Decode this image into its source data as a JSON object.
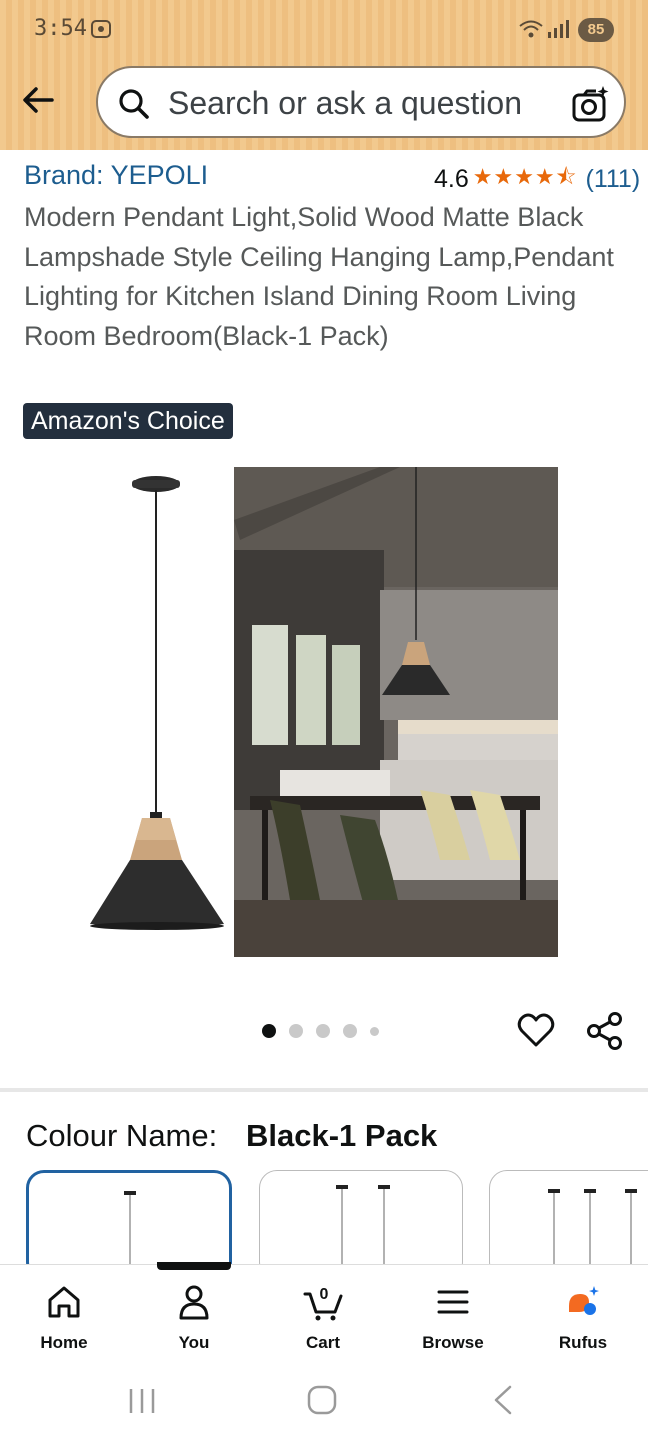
{
  "status_bar": {
    "time": "3:54",
    "battery": "85"
  },
  "search": {
    "placeholder": "Search or ask a question"
  },
  "product": {
    "brand": "Brand: YEPOLI",
    "rating": "4.6",
    "rating_stars": 4.5,
    "stars_glyphs": "★★★★⯪",
    "review_count": "(111)",
    "title": "Modern Pendant Light,Solid Wood Matte Black Lampshade Style Ceiling Hanging Lamp,Pendant Lighting for Kitchen Island Dining Room Living Room Bedroom(Black-1 Pack)",
    "badge": "Amazon's Choice"
  },
  "gallery": {
    "image_count": 5,
    "active_index": 0
  },
  "variant": {
    "label": "Colour Name:",
    "value": "Black-1 Pack"
  },
  "bottom_nav": {
    "items": [
      {
        "label": "Home",
        "icon": "home-icon"
      },
      {
        "label": "You",
        "icon": "person-icon"
      },
      {
        "label": "Cart",
        "icon": "cart-icon",
        "count": "0"
      },
      {
        "label": "Browse",
        "icon": "menu-icon"
      },
      {
        "label": "Rufus",
        "icon": "rufus-icon"
      }
    ]
  },
  "colors": {
    "link": "#1d5d8f",
    "star": "#e8690b",
    "badge_bg": "#232f3e",
    "selected_border": "#2162a1",
    "header_bg": "#f2c98e"
  }
}
